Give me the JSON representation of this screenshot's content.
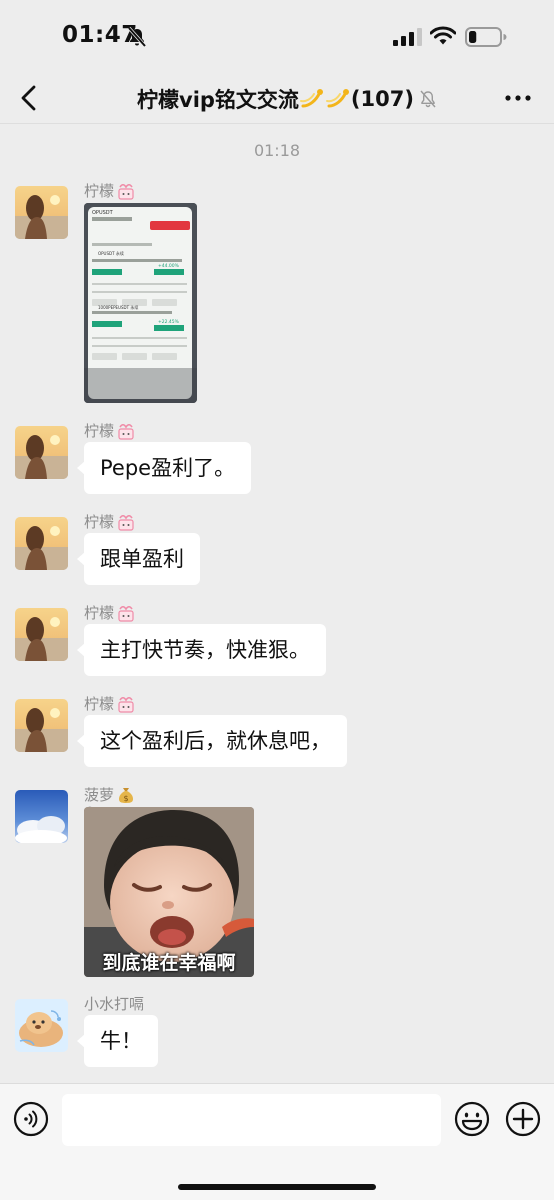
{
  "status_bar": {
    "time": "01:47",
    "battery_percent": 25
  },
  "header": {
    "title": "柠檬vip铭文交流",
    "member_count": "(107)",
    "icons": [
      "back-chevron-icon",
      "sparkle-icon",
      "mute-bell-icon",
      "more-icon"
    ]
  },
  "chat": {
    "timestamp": "01:18",
    "messages": [
      {
        "sender": "柠檬",
        "type": "image",
        "image_texts": [
          "OPUSDT",
          "OPUSDT 永续",
          "1000PEPEUSDT 永续",
          "+44.00%",
          "+22.45%",
          "214.47"
        ]
      },
      {
        "sender": "柠檬",
        "type": "text",
        "text": "Pepe盈利了。"
      },
      {
        "sender": "柠檬",
        "type": "text",
        "text": "跟单盈利"
      },
      {
        "sender": "柠檬",
        "type": "text",
        "text": "主打快节奏，快准狠。"
      },
      {
        "sender": "柠檬",
        "type": "text",
        "text": "这个盈利后，就休息吧，"
      },
      {
        "sender": "菠萝",
        "type": "sticker",
        "caption": "到底谁在幸福啊"
      },
      {
        "sender": "小水打嗝",
        "type": "text",
        "text": "牛！"
      }
    ]
  },
  "input_bar": {
    "value": "",
    "icons": [
      "voice-icon",
      "emoji-icon",
      "plus-icon"
    ]
  },
  "colors": {
    "background": "#ededed",
    "bubble": "#ffffff",
    "sender_name": "#8c8c8c",
    "timestamp": "#9a9a9a"
  }
}
